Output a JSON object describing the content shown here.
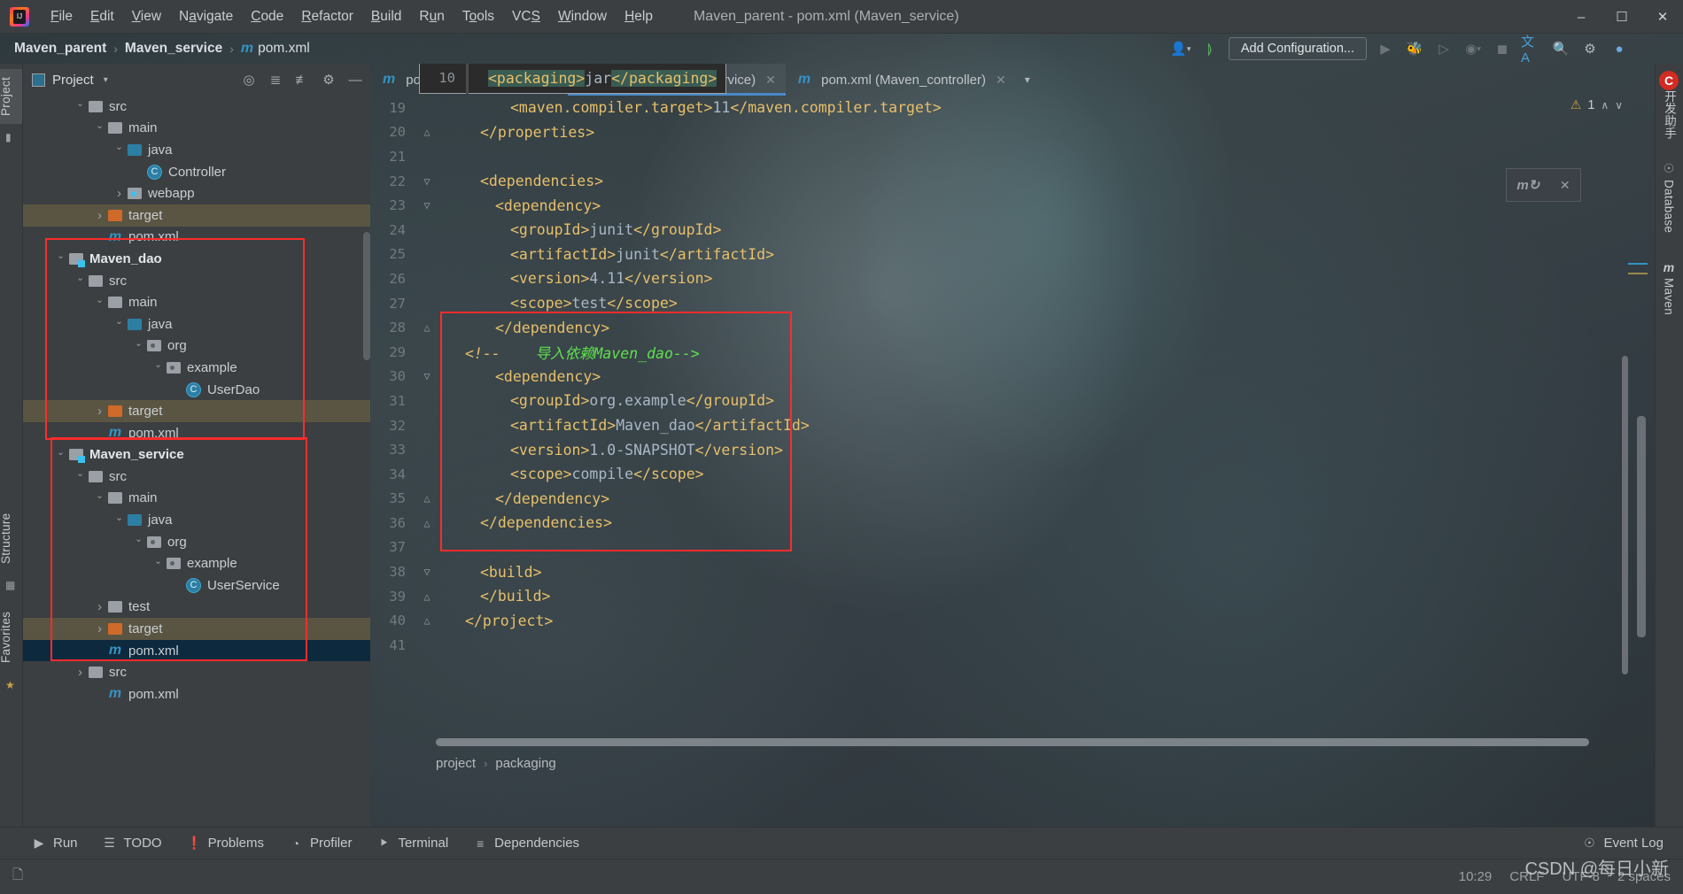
{
  "window": {
    "title": "Maven_parent - pom.xml (Maven_service)",
    "minimize": "–",
    "maximize": "☐",
    "close": "✕"
  },
  "menubar": {
    "items": [
      "File",
      "Edit",
      "View",
      "Navigate",
      "Code",
      "Refactor",
      "Build",
      "Run",
      "Tools",
      "VCS",
      "Window",
      "Help"
    ]
  },
  "navbar": {
    "breadcrumbs": [
      "Maven_parent",
      "Maven_service"
    ],
    "file": "pom.xml",
    "m_icon": "m",
    "add_configuration": "Add Configuration...",
    "icons": {
      "user": "user-icon",
      "hammer": "build-hammer-icon",
      "run": "run-icon",
      "debug": "debug-icon",
      "coverage": "coverage-icon",
      "profile": "profile-icon",
      "stop": "stop-icon",
      "translate": "translate-icon",
      "search": "search-icon",
      "settings": "settings-icon",
      "plugin": "plugin-icon"
    }
  },
  "left_strip": {
    "project_label": "Project",
    "structure_label": "Structure",
    "favorites_label": "Favorites"
  },
  "project_panel": {
    "title": "Project",
    "caret": "▾",
    "actions": [
      "locate-icon",
      "expand-all-icon",
      "collapse-all-icon",
      "gear-icon",
      "hide-icon"
    ],
    "tree": [
      {
        "indent": 2,
        "arrow": "down",
        "icon": "folder-grey",
        "label": "src",
        "state": ""
      },
      {
        "indent": 3,
        "arrow": "down",
        "icon": "folder-grey",
        "label": "main",
        "state": ""
      },
      {
        "indent": 4,
        "arrow": "down",
        "icon": "folder-blue",
        "label": "java",
        "state": ""
      },
      {
        "indent": 5,
        "arrow": "blank",
        "icon": "class",
        "label": "Controller",
        "state": ""
      },
      {
        "indent": 4,
        "arrow": "right",
        "icon": "folder-webapp",
        "label": "webapp",
        "state": ""
      },
      {
        "indent": 3,
        "arrow": "right",
        "icon": "folder-orange",
        "label": "target",
        "state": "hl-target"
      },
      {
        "indent": 3,
        "arrow": "blank",
        "icon": "maven",
        "label": "pom.xml",
        "state": ""
      },
      {
        "indent": 1,
        "arrow": "down",
        "icon": "module",
        "label": "Maven_dao",
        "state": "bold"
      },
      {
        "indent": 2,
        "arrow": "down",
        "icon": "folder-grey",
        "label": "src",
        "state": ""
      },
      {
        "indent": 3,
        "arrow": "down",
        "icon": "folder-grey",
        "label": "main",
        "state": ""
      },
      {
        "indent": 4,
        "arrow": "down",
        "icon": "folder-blue",
        "label": "java",
        "state": ""
      },
      {
        "indent": 5,
        "arrow": "down",
        "icon": "folder-pkg",
        "label": "org",
        "state": ""
      },
      {
        "indent": 6,
        "arrow": "down",
        "icon": "folder-pkg",
        "label": "example",
        "state": ""
      },
      {
        "indent": 7,
        "arrow": "blank",
        "icon": "class",
        "label": "UserDao",
        "state": ""
      },
      {
        "indent": 3,
        "arrow": "right",
        "icon": "folder-orange",
        "label": "target",
        "state": "hl-target"
      },
      {
        "indent": 3,
        "arrow": "blank",
        "icon": "maven",
        "label": "pom.xml",
        "state": ""
      },
      {
        "indent": 1,
        "arrow": "down",
        "icon": "module",
        "label": "Maven_service",
        "state": "bold"
      },
      {
        "indent": 2,
        "arrow": "down",
        "icon": "folder-grey",
        "label": "src",
        "state": ""
      },
      {
        "indent": 3,
        "arrow": "down",
        "icon": "folder-grey",
        "label": "main",
        "state": ""
      },
      {
        "indent": 4,
        "arrow": "down",
        "icon": "folder-blue",
        "label": "java",
        "state": ""
      },
      {
        "indent": 5,
        "arrow": "down",
        "icon": "folder-pkg",
        "label": "org",
        "state": ""
      },
      {
        "indent": 6,
        "arrow": "down",
        "icon": "folder-pkg",
        "label": "example",
        "state": ""
      },
      {
        "indent": 7,
        "arrow": "blank",
        "icon": "class",
        "label": "UserService",
        "state": ""
      },
      {
        "indent": 3,
        "arrow": "right",
        "icon": "folder-grey",
        "label": "test",
        "state": ""
      },
      {
        "indent": 3,
        "arrow": "right",
        "icon": "folder-orange",
        "label": "target",
        "state": "hl-target"
      },
      {
        "indent": 3,
        "arrow": "blank",
        "icon": "maven",
        "label": "pom.xml",
        "state": "selected"
      },
      {
        "indent": 2,
        "arrow": "right",
        "icon": "folder-grey",
        "label": "src",
        "state": ""
      },
      {
        "indent": 3,
        "arrow": "blank",
        "icon": "maven",
        "label": "pom.xml",
        "state": ""
      }
    ]
  },
  "editor": {
    "tabs": [
      {
        "label": "pom.xml (Maven_dao)",
        "active": false,
        "close": "✕"
      },
      {
        "label": "pom.xml (Maven_service)",
        "active": true,
        "close": "✕"
      },
      {
        "label": "pom.xml (Maven_controller)",
        "active": false,
        "close": "✕"
      }
    ],
    "tabs_overflow": "▾",
    "warnings": {
      "icon": "warning-triangle-icon",
      "count": "1",
      "prev": "∧",
      "next": "∨"
    },
    "sticky_popup": {
      "line": "10",
      "segments": [
        {
          "text": "<packaging>",
          "cls": "t-tag hl-sel"
        },
        {
          "text": "jar",
          "cls": "t-val"
        },
        {
          "text": "</packaging>",
          "cls": "t-tag hl-sel"
        }
      ]
    },
    "lines": [
      {
        "num": "19",
        "fold": "",
        "indent": 4,
        "segments": [
          {
            "text": "<maven.compiler.target>",
            "cls": "t-tag"
          },
          {
            "text": "11",
            "cls": "t-val"
          },
          {
            "text": "</maven.compiler.target>",
            "cls": "t-tag"
          }
        ]
      },
      {
        "num": "20",
        "fold": "△",
        "indent": 2,
        "segments": [
          {
            "text": "</properties>",
            "cls": "t-tag"
          }
        ]
      },
      {
        "num": "21",
        "fold": "",
        "indent": 0,
        "segments": []
      },
      {
        "num": "22",
        "fold": "▽",
        "indent": 2,
        "segments": [
          {
            "text": "<dependencies>",
            "cls": "t-tag"
          }
        ]
      },
      {
        "num": "23",
        "fold": "▽",
        "indent": 3,
        "segments": [
          {
            "text": "<dependency>",
            "cls": "t-tag"
          }
        ]
      },
      {
        "num": "24",
        "fold": "",
        "indent": 4,
        "segments": [
          {
            "text": "<groupId>",
            "cls": "t-tag"
          },
          {
            "text": "junit",
            "cls": "t-val"
          },
          {
            "text": "</groupId>",
            "cls": "t-tag"
          }
        ]
      },
      {
        "num": "25",
        "fold": "",
        "indent": 4,
        "segments": [
          {
            "text": "<artifactId>",
            "cls": "t-tag"
          },
          {
            "text": "junit",
            "cls": "t-val"
          },
          {
            "text": "</artifactId>",
            "cls": "t-tag"
          }
        ]
      },
      {
        "num": "26",
        "fold": "",
        "indent": 4,
        "segments": [
          {
            "text": "<version>",
            "cls": "t-tag"
          },
          {
            "text": "4.11",
            "cls": "t-val"
          },
          {
            "text": "</version>",
            "cls": "t-tag"
          }
        ]
      },
      {
        "num": "27",
        "fold": "",
        "indent": 4,
        "segments": [
          {
            "text": "<scope>",
            "cls": "t-tag"
          },
          {
            "text": "test",
            "cls": "t-val"
          },
          {
            "text": "</scope>",
            "cls": "t-tag"
          }
        ]
      },
      {
        "num": "28",
        "fold": "△",
        "indent": 3,
        "segments": [
          {
            "text": "</dependency>",
            "cls": "t-tag"
          }
        ]
      },
      {
        "num": "29",
        "fold": "",
        "indent": 1,
        "segments": [
          {
            "text": "<!--",
            "cls": "t-com-mark"
          },
          {
            "text": "    导入依赖Maven_dao-->",
            "cls": "t-com"
          }
        ]
      },
      {
        "num": "30",
        "fold": "▽",
        "indent": 3,
        "segments": [
          {
            "text": "<dependency>",
            "cls": "t-tag"
          }
        ]
      },
      {
        "num": "31",
        "fold": "",
        "indent": 4,
        "segments": [
          {
            "text": "<groupId>",
            "cls": "t-tag"
          },
          {
            "text": "org.example",
            "cls": "t-val"
          },
          {
            "text": "</groupId>",
            "cls": "t-tag"
          }
        ]
      },
      {
        "num": "32",
        "fold": "",
        "indent": 4,
        "segments": [
          {
            "text": "<artifactId>",
            "cls": "t-tag"
          },
          {
            "text": "Maven_dao",
            "cls": "t-val"
          },
          {
            "text": "</artifactId>",
            "cls": "t-tag"
          }
        ]
      },
      {
        "num": "33",
        "fold": "",
        "indent": 4,
        "segments": [
          {
            "text": "<version>",
            "cls": "t-tag"
          },
          {
            "text": "1.0-SNAPSHOT",
            "cls": "t-val"
          },
          {
            "text": "</version>",
            "cls": "t-tag"
          }
        ]
      },
      {
        "num": "34",
        "fold": "",
        "indent": 4,
        "segments": [
          {
            "text": "<scope>",
            "cls": "t-tag"
          },
          {
            "text": "compile",
            "cls": "t-val"
          },
          {
            "text": "</scope>",
            "cls": "t-tag"
          }
        ]
      },
      {
        "num": "35",
        "fold": "△",
        "indent": 3,
        "segments": [
          {
            "text": "</dependency>",
            "cls": "t-tag"
          }
        ]
      },
      {
        "num": "36",
        "fold": "△",
        "indent": 2,
        "segments": [
          {
            "text": "</dependencies>",
            "cls": "t-tag"
          }
        ]
      },
      {
        "num": "37",
        "fold": "",
        "indent": 0,
        "segments": []
      },
      {
        "num": "38",
        "fold": "▽",
        "indent": 2,
        "segments": [
          {
            "text": "<build>",
            "cls": "t-tag"
          }
        ]
      },
      {
        "num": "39",
        "fold": "△",
        "indent": 2,
        "segments": [
          {
            "text": "</build>",
            "cls": "t-tag"
          }
        ]
      },
      {
        "num": "40",
        "fold": "△",
        "indent": 1,
        "segments": [
          {
            "text": "</project>",
            "cls": "t-tag"
          }
        ]
      },
      {
        "num": "41",
        "fold": "",
        "indent": 0,
        "segments": []
      }
    ],
    "breadcrumb": [
      "project",
      "packaging"
    ],
    "breadcrumb_sep": "›"
  },
  "float_chip": {
    "icon": "maven-reload-icon",
    "close": "✕"
  },
  "right_strip": {
    "items": [
      {
        "label": "开发助手",
        "icon": "c-badge"
      },
      {
        "label": "Database",
        "icon": "database-icon"
      },
      {
        "label": "Maven",
        "icon": "maven-m-icon"
      }
    ]
  },
  "bottom_bar": {
    "items": [
      {
        "label": "Run",
        "icon": "run-triangle-icon"
      },
      {
        "label": "TODO",
        "icon": "todo-list-icon"
      },
      {
        "label": "Problems",
        "icon": "problems-icon"
      },
      {
        "label": "Profiler",
        "icon": "profiler-icon"
      },
      {
        "label": "Terminal",
        "icon": "terminal-icon"
      },
      {
        "label": "Dependencies",
        "icon": "dependencies-icon"
      }
    ],
    "event_log": {
      "label": "Event Log",
      "icon": "event-log-icon"
    }
  },
  "status_bar": {
    "left_icon": "copy-icon",
    "time": "10:29",
    "line_separator": "CRLF",
    "encoding": "UTF-8",
    "indent": "2 spaces"
  },
  "watermark": "CSDN @每日小新",
  "colors": {
    "accent_blue": "#4a88c7",
    "tag_orange": "#e8bf6a",
    "value_blue": "#a9b7c6",
    "comment_green": "#5fe04e",
    "annotation_red": "#fb2c2c",
    "panel_bg": "#3c3f41",
    "selected_row": "#0d293e"
  }
}
